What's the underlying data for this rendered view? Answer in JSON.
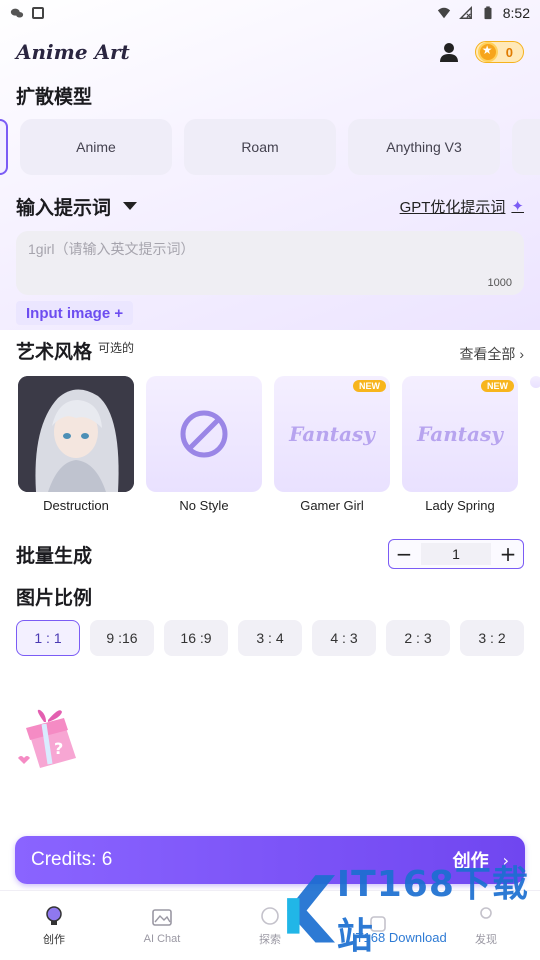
{
  "status_bar": {
    "time": "8:52"
  },
  "header": {
    "title": "Anime Art",
    "coins": "0"
  },
  "models": {
    "title": "扩散模型",
    "items": [
      "Anime",
      "Roam",
      "Anything V3"
    ]
  },
  "prompt": {
    "title": "输入提示词",
    "gpt_link": "GPT优化提示词",
    "placeholder": "1girl（请输入英文提示词）",
    "limit": "1000",
    "input_image": "Input image +"
  },
  "art_styles": {
    "title": "艺术风格",
    "optional": "可选的",
    "view_all": "查看全部 ›",
    "items": [
      {
        "label": "Destruction",
        "badge": ""
      },
      {
        "label": "No Style",
        "badge": ""
      },
      {
        "label": "Gamer Girl",
        "badge": "NEW",
        "thumb_text": "Fantasy"
      },
      {
        "label": "Lady Spring",
        "badge": "NEW",
        "thumb_text": "Fantasy"
      }
    ]
  },
  "batch": {
    "title": "批量生成",
    "value": "1",
    "minus": "−",
    "plus": "+"
  },
  "ratio": {
    "title": "图片比例",
    "items": [
      "1 : 1",
      "9 :16",
      "16 :9",
      "3 : 4",
      "4 : 3",
      "2 : 3",
      "3 : 2"
    ],
    "selected": "1 : 1"
  },
  "credits": {
    "label": "Credits: 6",
    "create": "创作",
    "chevron": "›"
  },
  "nav": {
    "items": [
      "创作",
      "AI Chat",
      "探索",
      "",
      "发现"
    ],
    "active": "创作"
  },
  "watermark": {
    "text": "IT168下载站",
    "sub": "IT168 Download"
  },
  "colors": {
    "accent": "#7b5cf5",
    "coin": "#f7a51c",
    "badge": "#f7b51d"
  }
}
